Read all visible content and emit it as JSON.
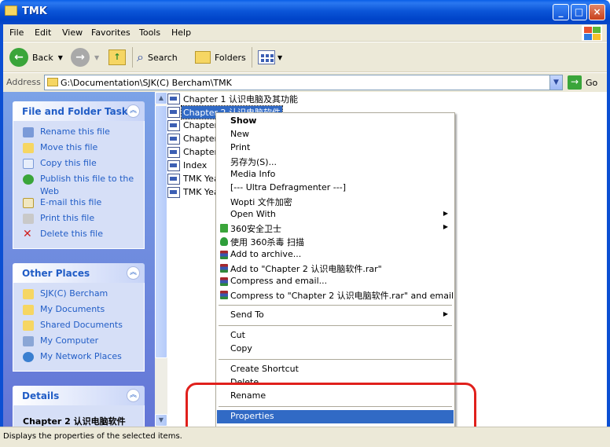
{
  "window": {
    "title": "TMK",
    "min_symbol": "_",
    "max_symbol": "□",
    "close_symbol": "×"
  },
  "menu": [
    "File",
    "Edit",
    "View",
    "Favorites",
    "Tools",
    "Help"
  ],
  "toolbar": {
    "back": "Back",
    "search": "Search",
    "folders": "Folders"
  },
  "address": {
    "label": "Address",
    "path": "G:\\Documentation\\SJK(C) Bercham\\TMK",
    "go": "Go"
  },
  "tasks_panel": {
    "title": "File and Folder Tasks",
    "items": [
      "Rename this file",
      "Move this file",
      "Copy this file",
      "Publish this file to the Web",
      "E-mail this file",
      "Print this file",
      "Delete this file"
    ]
  },
  "places_panel": {
    "title": "Other Places",
    "items": [
      "SJK(C) Bercham",
      "My Documents",
      "Shared Documents",
      "My Computer",
      "My Network Places"
    ]
  },
  "details_panel": {
    "title": "Details",
    "filename": "Chapter 2 认识电脑软件"
  },
  "files": [
    {
      "name": "Chapter 1 认识电脑及其功能",
      "selected": false
    },
    {
      "name": "Chapter 2 认识电脑软件",
      "selected": true
    },
    {
      "name": "Chapter",
      "selected": false
    },
    {
      "name": "Chapter",
      "selected": false
    },
    {
      "name": "Chapter",
      "selected": false
    },
    {
      "name": "Index",
      "selected": false
    },
    {
      "name": "TMK Year",
      "selected": false
    },
    {
      "name": "TMK Year",
      "selected": false
    }
  ],
  "context_menu": {
    "items": [
      {
        "label": "Show",
        "bold": true
      },
      {
        "label": "New"
      },
      {
        "label": "Print"
      },
      {
        "label": "另存为(S)..."
      },
      {
        "label": "Media Info"
      },
      {
        "label": "[--- Ultra Defragmenter ---]"
      },
      {
        "label": "Wopti 文件加密"
      },
      {
        "label": "Open With",
        "submenu": true
      },
      {
        "label": "360安全卫士",
        "submenu": true,
        "icon": "360-safe-icon"
      },
      {
        "label": "使用 360杀毒 扫描",
        "icon": "360-antivirus-icon"
      },
      {
        "label": "Add to archive...",
        "icon": "winrar-icon"
      },
      {
        "label": "Add to \"Chapter 2 认识电脑软件.rar\"",
        "icon": "winrar-icon"
      },
      {
        "label": "Compress and email...",
        "icon": "winrar-icon"
      },
      {
        "label": "Compress to \"Chapter 2 认识电脑软件.rar\" and email",
        "icon": "winrar-icon"
      },
      {
        "label": "Send To",
        "submenu": true
      },
      {
        "label": "Cut"
      },
      {
        "label": "Copy"
      },
      {
        "label": "Create Shortcut"
      },
      {
        "label": "Delete"
      },
      {
        "label": "Rename"
      },
      {
        "label": "Properties",
        "highlighted": true
      }
    ]
  },
  "status": {
    "text": "Displays the properties of the selected items."
  },
  "colors": {
    "selection": "#316ac5",
    "annotation": "#e0201c",
    "task_link": "#215dc6"
  }
}
